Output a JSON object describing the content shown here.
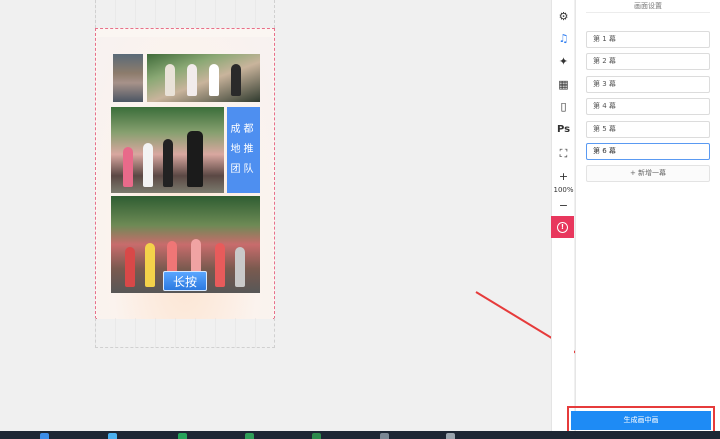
{
  "canvas": {
    "banner_lines": [
      "成都",
      "地推",
      "团队"
    ],
    "press_button": "长按"
  },
  "tools": {
    "items": [
      {
        "name": "settings",
        "glyph": "⚙"
      },
      {
        "name": "music",
        "glyph": "♫"
      },
      {
        "name": "effects",
        "glyph": "✦"
      },
      {
        "name": "grid",
        "glyph": "▦"
      },
      {
        "name": "phone-preview",
        "glyph": "▯"
      },
      {
        "name": "photoshop",
        "glyph": "Ps"
      },
      {
        "name": "capture",
        "glyph": "⛶"
      }
    ],
    "zoom_in": "+",
    "zoom_level": "100%",
    "zoom_out": "−",
    "info": "!"
  },
  "panel": {
    "title": "画面设置",
    "scenes": [
      "第 1 幕",
      "第 2 幕",
      "第 3 幕",
      "第 4 幕",
      "第 5 幕",
      "第 6 幕"
    ],
    "active_scene_index": 5,
    "add_scene": "+ 新增一幕",
    "generate_button": "生成画中画"
  },
  "colors": {
    "accent": "#1e8bf5",
    "highlight": "#e63b3b",
    "banner": "#4e8ff0",
    "info": "#e8375d"
  }
}
